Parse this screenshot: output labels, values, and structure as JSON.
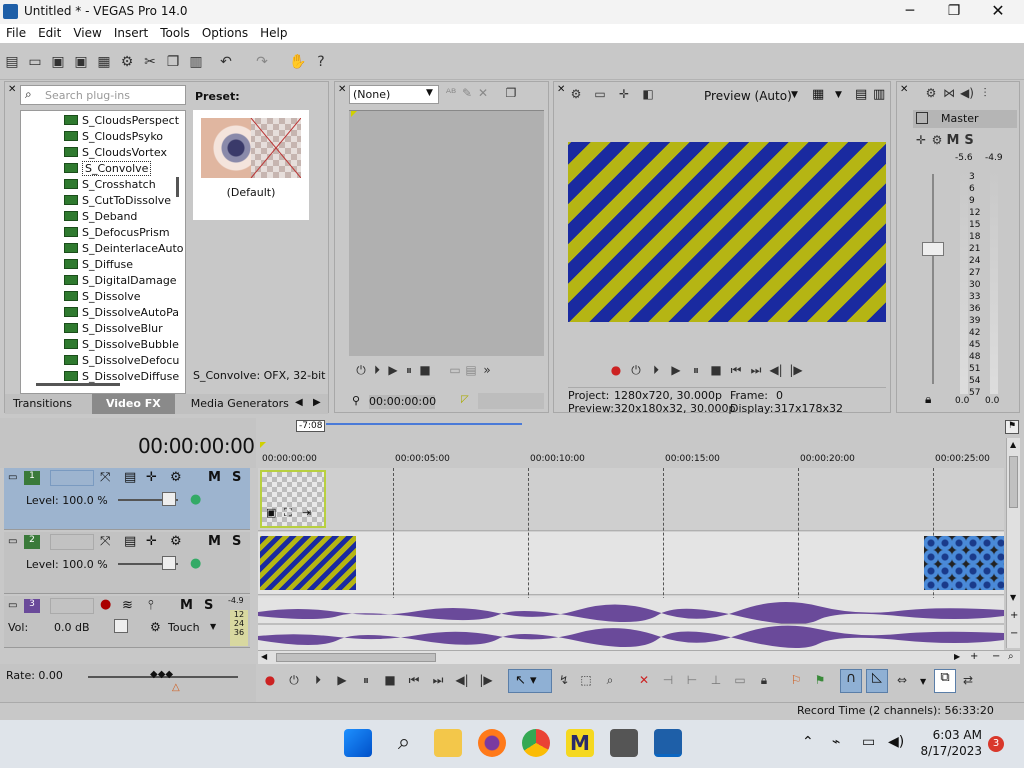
{
  "window": {
    "title": "Untitled * - VEGAS Pro 14.0",
    "minimize_icon": "minimize-icon",
    "maximize_icon": "maximize-icon",
    "close_icon": "close-icon"
  },
  "menu": {
    "items": [
      "File",
      "Edit",
      "View",
      "Insert",
      "Tools",
      "Options",
      "Help"
    ]
  },
  "plugins": {
    "search_placeholder": "Search plug-ins",
    "items": [
      "S_CloudsPerspect",
      "S_CloudsPsyko",
      "S_CloudsVortex",
      "S_Convolve",
      "S_Crosshatch",
      "S_CutToDissolve",
      "S_Deband",
      "S_DefocusPrism",
      "S_DeinterlaceAuto",
      "S_Diffuse",
      "S_DigitalDamage",
      "S_Dissolve",
      "S_DissolveAutoPa",
      "S_DissolveBlur",
      "S_DissolveBubble",
      "S_DissolveDefocu",
      "S_DissolveDiffuse"
    ],
    "selected_index": 3,
    "preset_label": "Preset:",
    "preset_name": "(Default)",
    "status": "S_Convolve: OFX, 32-bit fl",
    "tabs": [
      "Transitions",
      "Video FX",
      "Media Generators"
    ],
    "active_tab": 1
  },
  "trimmer": {
    "dropdown_value": "(None)",
    "timecode": "00:00:00:00"
  },
  "preview": {
    "mode": "Preview (Auto)",
    "project_label": "Project:",
    "project_value": "1280x720, 30.000p",
    "frame_label": "Frame:",
    "frame_value": "0",
    "preview_label": "Preview:",
    "preview_value": "320x180x32, 30.000p",
    "display_label": "Display:",
    "display_value": "317x178x32"
  },
  "mixer": {
    "title": "Master",
    "db_left": "-5.6",
    "db_right": "-4.9",
    "scale": [
      "3",
      "6",
      "9",
      "12",
      "15",
      "18",
      "21",
      "24",
      "27",
      "30",
      "33",
      "36",
      "39",
      "42",
      "45",
      "48",
      "51",
      "54",
      "57"
    ],
    "bottom_left": "0.0",
    "bottom_right": "0.0"
  },
  "timeline": {
    "timecode": "00:00:00:00",
    "loop_marker": "-7:08",
    "ruler": [
      "00:00:00:00",
      "00:00:05:00",
      "00:00:10:00",
      "00:00:15:00",
      "00:00:20:00",
      "00:00:25:00"
    ],
    "tracks": [
      {
        "num": "1",
        "level": "Level: 100.0 %"
      },
      {
        "num": "2",
        "level": "Level: 100.0 %"
      },
      {
        "num": "3",
        "vol_label": "Vol:",
        "vol_value": "0.0 dB",
        "mode": "Touch",
        "meter_val": "-4.9",
        "meter_scale": [
          "12",
          "24",
          "36"
        ]
      }
    ],
    "rate": "Rate: 0.00",
    "record_time": "Record Time (2 channels): 56:33:20"
  },
  "taskbar": {
    "time": "6:03 AM",
    "date": "8/17/2023",
    "notif_count": "3"
  },
  "colors": {
    "stripe_blue": "#1a2aa0",
    "stripe_yellow": "#b5b514",
    "audio": "#6a4a9a",
    "selected_track": "#9db4cf"
  }
}
